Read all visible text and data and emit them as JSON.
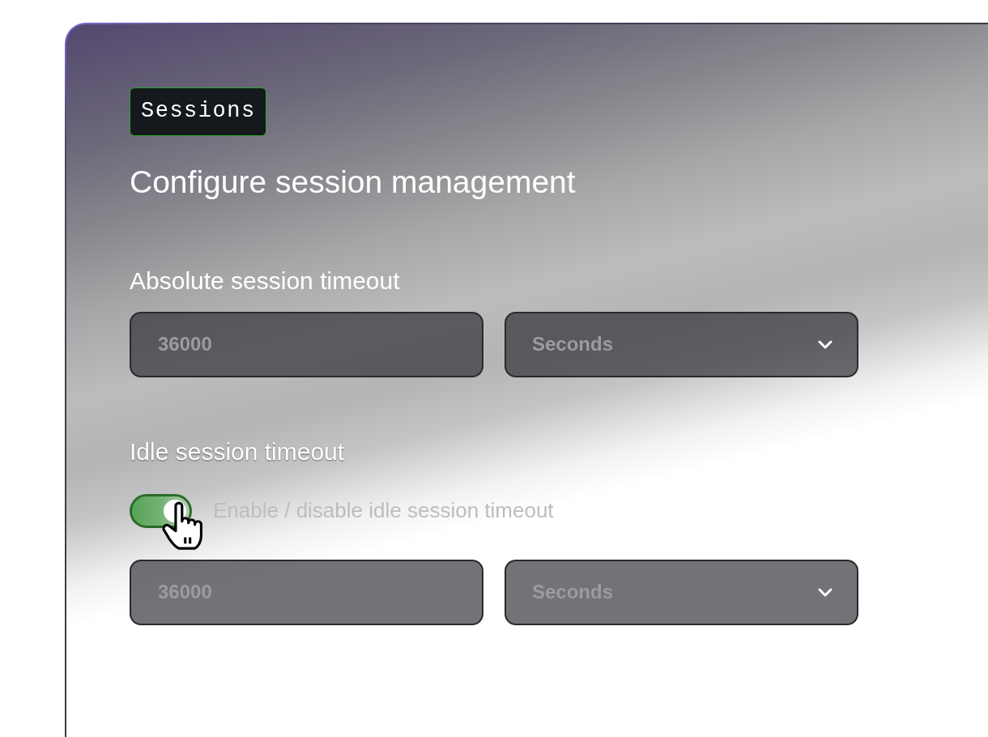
{
  "section_tag": "Sessions",
  "heading": "Configure session management",
  "settings": [
    {
      "label": "Absolute session timeout",
      "amount": "36000",
      "unit": "Seconds"
    },
    {
      "label": "Idle session timeout",
      "toggle": {
        "label": "Enable / disable idle session timeout",
        "on": true
      },
      "amount": "36000",
      "unit": "Seconds"
    }
  ]
}
